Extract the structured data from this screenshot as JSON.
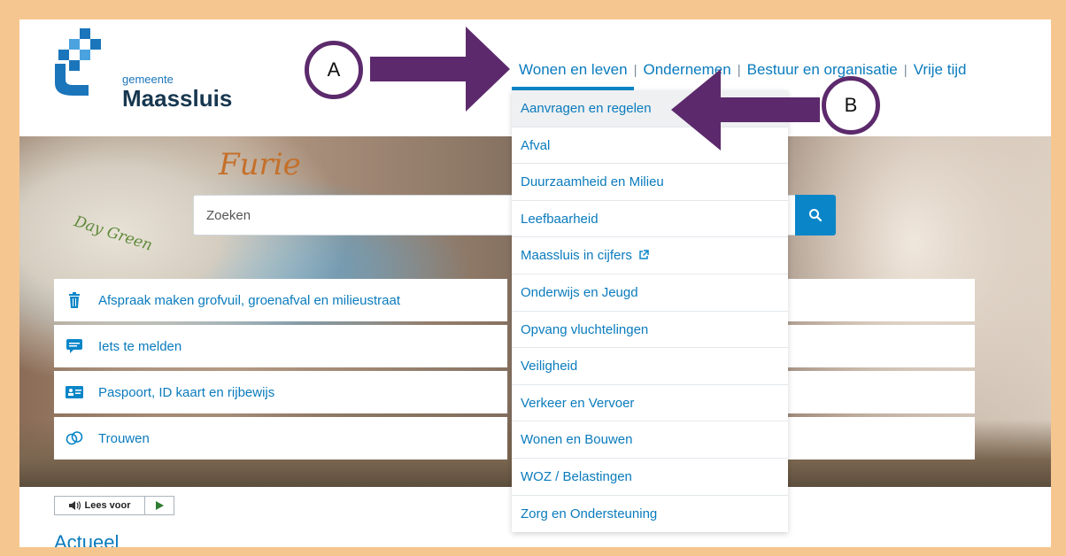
{
  "logo": {
    "small": "gemeente",
    "name": "Maassluis"
  },
  "nav": {
    "items": [
      "Wonen en leven",
      "Ondernemen",
      "Bestuur en organisatie",
      "Vrije tijd"
    ],
    "separator": "|"
  },
  "hero": {
    "painted_text_1": "Furie",
    "painted_text_2": "Day Green"
  },
  "search": {
    "placeholder": "Zoeken",
    "button_icon": "search-icon"
  },
  "quick_links": [
    {
      "label": "Afspraak maken grofvuil, groenafval en milieustraat",
      "icon": "trash-icon"
    },
    {
      "label": "Iets te melden",
      "icon": "chat-icon"
    },
    {
      "label": "Paspoort, ID kaart en rijbewijs",
      "icon": "id-card-icon"
    },
    {
      "label": "Trouwen",
      "icon": "rings-icon"
    }
  ],
  "dropdown": {
    "items": [
      "Aanvragen en regelen",
      "Afval",
      "Duurzaamheid en Milieu",
      "Leefbaarheid",
      "Maassluis in cijfers",
      "Onderwijs en Jeugd",
      "Opvang vluchtelingen",
      "Veiligheid",
      "Verkeer en Vervoer",
      "Wonen en Bouwen",
      "WOZ / Belastingen",
      "Zorg en Ondersteuning"
    ]
  },
  "leesvoor": {
    "label": "Lees voor"
  },
  "section": {
    "title": "Actueel"
  },
  "annotations": {
    "a": "A",
    "b": "B"
  },
  "colors": {
    "brand_blue": "#0a86c8",
    "link": "#0a7bbd",
    "arrow": "#5c2a6c",
    "frame": "#f6c690"
  }
}
